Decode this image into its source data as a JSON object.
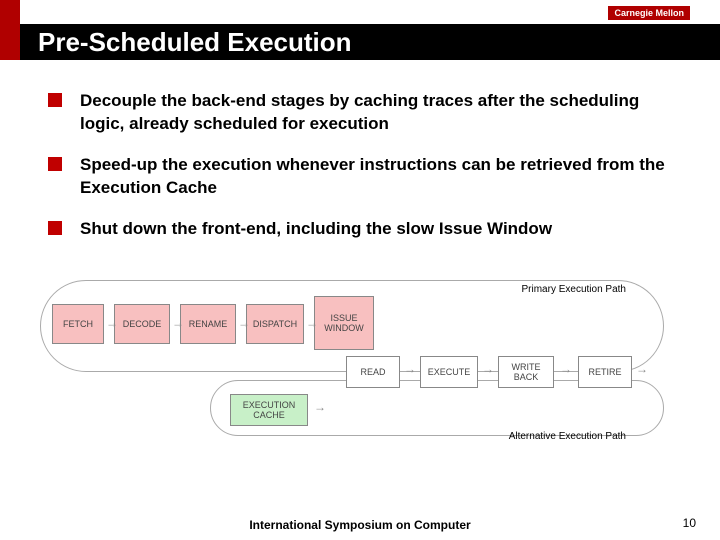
{
  "logo": "Carnegie Mellon",
  "title": "Pre-Scheduled Execution",
  "bullets": [
    "Decouple the back-end stages by caching traces after the scheduling logic, already scheduled for execution",
    "Speed-up the execution whenever instructions can be retrieved from the Execution Cache",
    "Shut down the front-end, including the slow Issue Window"
  ],
  "diagram": {
    "primary_label": "Primary Execution Path",
    "alt_label": "Alternative Execution Path",
    "stages": {
      "fetch": "FETCH",
      "decode": "DECODE",
      "rename": "RENAME",
      "dispatch": "DISPATCH",
      "issue": "ISSUE WINDOW",
      "read": "READ",
      "execute": "EXECUTE",
      "writeback": "WRITE BACK",
      "retire": "RETIRE",
      "execcache": "EXECUTION CACHE"
    }
  },
  "footer": "International Symposium on Computer",
  "page": "10"
}
